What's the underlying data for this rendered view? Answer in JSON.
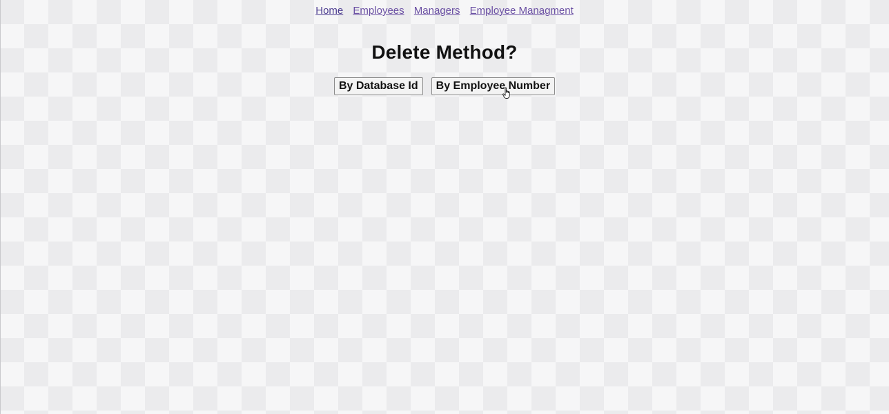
{
  "nav": {
    "links": [
      {
        "label": "Home"
      },
      {
        "label": "Employees"
      },
      {
        "label": "Managers"
      },
      {
        "label": "Employee Managment"
      }
    ]
  },
  "main": {
    "title": "Delete Method?",
    "buttons": {
      "by_database_id": "By Database Id",
      "by_employee_number": "By Employee Number"
    }
  },
  "colors": {
    "link": "#4b3b8f",
    "title": "#111111",
    "background": "#ebebed"
  },
  "cursor": {
    "icon": "hand-pointer-icon"
  }
}
